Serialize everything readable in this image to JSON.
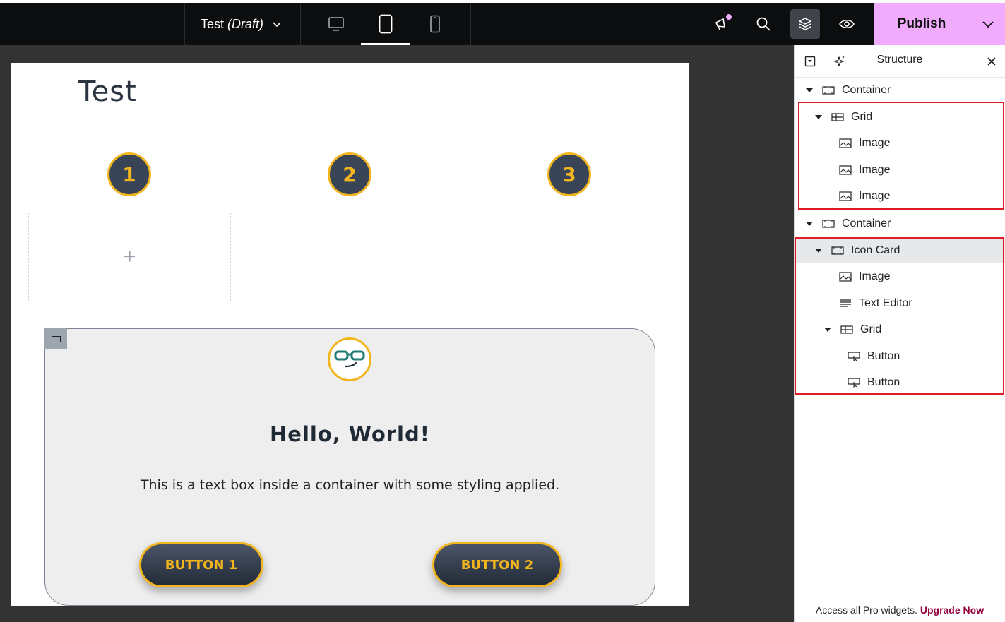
{
  "topbar": {
    "doc_title": "Test",
    "doc_status": "(Draft)",
    "devices": [
      {
        "name": "desktop-icon",
        "active": false
      },
      {
        "name": "tablet-icon",
        "active": true
      },
      {
        "name": "mobile-icon",
        "active": false
      }
    ],
    "tools": [
      "announcements-icon",
      "search-icon",
      "structure-icon",
      "preview-icon"
    ],
    "publish_label": "Publish",
    "accent_color": "#f0abfc"
  },
  "canvas": {
    "page_title": "Test",
    "numbers": [
      "1",
      "2",
      "3"
    ],
    "add_symbol": "+",
    "card": {
      "heading": "Hello, World!",
      "text": "This is a text box inside a container with some styling applied.",
      "button1": "BUTTON 1",
      "button2": "BUTTON 2",
      "accent_color": "#f2b51e",
      "icon": "nerd-face-glasses-icon"
    }
  },
  "structure": {
    "title": "Structure",
    "items": [
      {
        "label": "Container",
        "icon": "container-icon",
        "expanded": true
      },
      {
        "label": "Grid",
        "icon": "grid-icon",
        "expanded": true
      },
      {
        "label": "Image",
        "icon": "image-icon"
      },
      {
        "label": "Image",
        "icon": "image-icon"
      },
      {
        "label": "Image",
        "icon": "image-icon"
      },
      {
        "label": "Container",
        "icon": "container-icon",
        "expanded": true
      },
      {
        "label": "Icon Card",
        "icon": "container-icon",
        "expanded": true,
        "selected": true
      },
      {
        "label": "Image",
        "icon": "image-icon"
      },
      {
        "label": "Text Editor",
        "icon": "text-editor-icon"
      },
      {
        "label": "Grid",
        "icon": "grid-icon",
        "expanded": true
      },
      {
        "label": "Button",
        "icon": "button-icon"
      },
      {
        "label": "Button",
        "icon": "button-icon"
      }
    ],
    "footer_text": "Access all Pro widgets.",
    "footer_link": "Upgrade Now",
    "highlight_color": "#e01b24"
  }
}
